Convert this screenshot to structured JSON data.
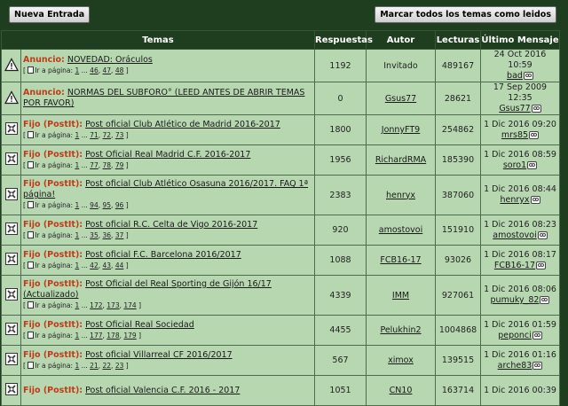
{
  "toolbar": {
    "new_entry_label": "Nueva Entrada",
    "mark_read_label": "Marcar todos los temas como leidos"
  },
  "columns": {
    "topics": "Temas",
    "replies": "Respuestas",
    "author": "Autor",
    "reads": "Lecturas",
    "last": "Último Mensaje"
  },
  "pages_label": "Ir a página:",
  "rows": [
    {
      "icon": "announcement-icon",
      "prefix": "Anuncio:",
      "title": "NOVEDAD: Oráculos",
      "pages": [
        "1",
        "...",
        "46",
        "47",
        "48"
      ],
      "replies": "1192",
      "author": "Invitado",
      "reads": "489167",
      "last_date": "24 Oct 2016 10:59",
      "last_user": "bad"
    },
    {
      "icon": "announcement-icon",
      "prefix": "Anuncio:",
      "title": "NORMAS DEL SUBFORO° (LEED ANTES DE ABRIR TEMAS POR FAVOR)",
      "pages": [],
      "replies": "0",
      "author": "Gsus77",
      "reads": "28621",
      "last_date": "17 Sep 2009 12:35",
      "last_user": "Gsus77"
    },
    {
      "icon": "sticky-icon",
      "prefix": "Fijo (PostIt):",
      "title": "Post oficial Club Atlético de Madrid 2016-2017",
      "pages": [
        "1",
        "...",
        "71",
        "72",
        "73"
      ],
      "replies": "1800",
      "author": "JonnyFT9",
      "reads": "254862",
      "last_date": "1 Dic 2016 09:20",
      "last_user": "mrs85"
    },
    {
      "icon": "sticky-icon",
      "prefix": "Fijo (PostIt):",
      "title": "Post Oficial Real Madrid C.F. 2016-2017",
      "pages": [
        "1",
        "...",
        "77",
        "78",
        "79"
      ],
      "replies": "1956",
      "author": "RichardRMA",
      "reads": "185390",
      "last_date": "1 Dic 2016 08:59",
      "last_user": "soro1"
    },
    {
      "icon": "sticky-icon",
      "prefix": "Fijo (PostIt):",
      "title": "Post oficial Club Atlético Osasuna 2016/2017. FAQ 1ª página!",
      "pages": [
        "1",
        "...",
        "94",
        "95",
        "96"
      ],
      "replies": "2383",
      "author": "henryx",
      "reads": "387060",
      "last_date": "1 Dic 2016 08:44",
      "last_user": "henryx"
    },
    {
      "icon": "sticky-icon",
      "prefix": "Fijo (PostIt):",
      "title": "Post oficial R.C. Celta de Vigo 2016-2017",
      "pages": [
        "1",
        "...",
        "35",
        "36",
        "37"
      ],
      "replies": "920",
      "author": "amostovoi",
      "reads": "151910",
      "last_date": "1 Dic 2016 08:23",
      "last_user": "amostovoi"
    },
    {
      "icon": "sticky-icon",
      "prefix": "Fijo (PostIt):",
      "title": "Post oficial F.C. Barcelona 2016/2017",
      "pages": [
        "1",
        "...",
        "42",
        "43",
        "44"
      ],
      "replies": "1088",
      "author": "FCB16-17",
      "reads": "93026",
      "last_date": "1 Dic 2016 08:17",
      "last_user": "FCB16-17"
    },
    {
      "icon": "sticky-icon",
      "prefix": "Fijo (PostIt):",
      "title": "Post Oficial del Real Sporting de Gijón 16/17 (Actualizado)",
      "pages": [
        "1",
        "...",
        "172",
        "173",
        "174"
      ],
      "replies": "4339",
      "author": "IMM",
      "reads": "927061",
      "last_date": "1 Dic 2016 08:06",
      "last_user": "pumuky_82"
    },
    {
      "icon": "sticky-icon",
      "prefix": "Fijo (PostIt):",
      "title": "Post Oficial Real Sociedad",
      "pages": [
        "1",
        "...",
        "177",
        "178",
        "179"
      ],
      "replies": "4455",
      "author": "Pelukhin2",
      "reads": "1004868",
      "last_date": "1 Dic 2016 01:59",
      "last_user": "peponci"
    },
    {
      "icon": "sticky-icon",
      "prefix": "Fijo (PostIt):",
      "title": "Post oficial Villarreal CF 2016/2017",
      "pages": [
        "1",
        "...",
        "21",
        "22",
        "23"
      ],
      "replies": "567",
      "author": "ximox",
      "reads": "139515",
      "last_date": "1 Dic 2016 01:16",
      "last_user": "arche83"
    },
    {
      "icon": "sticky-icon",
      "prefix": "Fijo (PostIt):",
      "title": "Post oficial Valencia C.F. 2016 - 2017",
      "pages": [],
      "replies": "1051",
      "author": "CN10",
      "reads": "163714",
      "last_date": "1 Dic 2016 00:39",
      "last_user": ""
    }
  ]
}
